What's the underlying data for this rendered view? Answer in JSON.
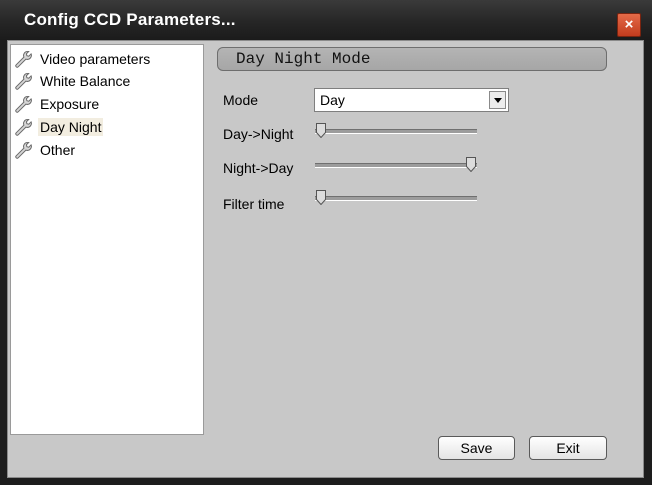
{
  "window": {
    "title": "Config CCD Parameters...",
    "close_label": "×"
  },
  "tree": {
    "items": [
      {
        "label": "Video parameters",
        "icon": "wrench-icon"
      },
      {
        "label": "White Balance",
        "icon": "wrench-icon"
      },
      {
        "label": "Exposure",
        "icon": "wrench-icon"
      },
      {
        "label": "Day Night",
        "icon": "wrench-icon",
        "selected": true
      },
      {
        "label": "Other",
        "icon": "wrench-icon"
      }
    ]
  },
  "panel": {
    "header": "Day Night Mode",
    "mode": {
      "label": "Mode",
      "value": "Day"
    },
    "sliders": [
      {
        "label": "Day->Night",
        "value": 0
      },
      {
        "label": "Night->Day",
        "value": 1
      },
      {
        "label": "Filter time",
        "value": 0
      }
    ]
  },
  "buttons": {
    "save": "Save",
    "exit": "Exit"
  }
}
